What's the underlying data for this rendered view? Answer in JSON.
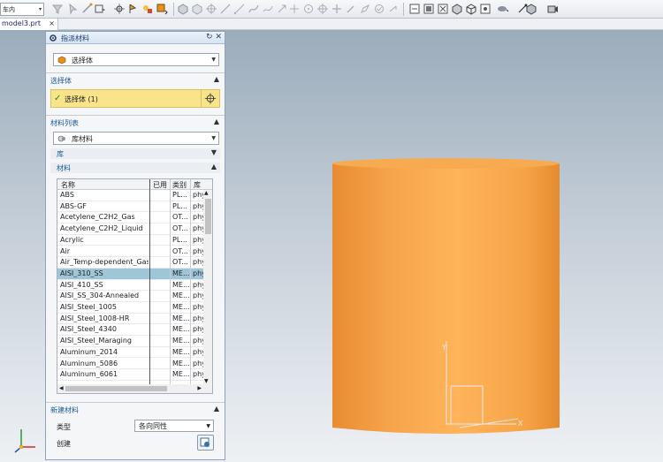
{
  "toolbar": {
    "filter_value": "车内",
    "filter_arrow": "▾"
  },
  "file_tab": {
    "name": "model3.prt",
    "close": "×"
  },
  "dialog": {
    "title": "指派材料",
    "title_buttons": "↻ ✕",
    "selection_type": "选择体",
    "select_body_section": "选择体",
    "select_body_status": "选择体 (1)",
    "material_list_section": "材料列表",
    "library_combo": "库材料",
    "library_subsection": "库",
    "material_subsection": "材料",
    "columns": {
      "name": "名称",
      "used": "已用",
      "class": "类别",
      "library": "库"
    },
    "materials": [
      {
        "name": "ABS",
        "class": "PL...",
        "library": "phy"
      },
      {
        "name": "ABS-GF",
        "class": "PL...",
        "library": "phy"
      },
      {
        "name": "Acetylene_C2H2_Gas",
        "class": "OT...",
        "library": "phy"
      },
      {
        "name": "Acetylene_C2H2_Liquid",
        "class": "OT...",
        "library": "phy"
      },
      {
        "name": "Acrylic",
        "class": "PL...",
        "library": "phy"
      },
      {
        "name": "Air",
        "class": "OT...",
        "library": "phy"
      },
      {
        "name": "Air_Temp-dependent_Gas",
        "class": "OT...",
        "library": "phy"
      },
      {
        "name": "AISI_310_SS",
        "class": "ME...",
        "library": "phy"
      },
      {
        "name": "AISI_410_SS",
        "class": "ME...",
        "library": "phy"
      },
      {
        "name": "AISI_SS_304-Annealed",
        "class": "ME...",
        "library": "phy"
      },
      {
        "name": "AISI_Steel_1005",
        "class": "ME...",
        "library": "phy"
      },
      {
        "name": "AISI_Steel_1008-HR",
        "class": "ME...",
        "library": "phy"
      },
      {
        "name": "AISI_Steel_4340",
        "class": "ME...",
        "library": "phy"
      },
      {
        "name": "AISI_Steel_Maraging",
        "class": "ME...",
        "library": "phy"
      },
      {
        "name": "Aluminum_2014",
        "class": "ME...",
        "library": "phy"
      },
      {
        "name": "Aluminum_5086",
        "class": "ME...",
        "library": "phy"
      },
      {
        "name": "Aluminum_6061",
        "class": "ME...",
        "library": "phy"
      }
    ],
    "selected_material": "AISI_310_SS",
    "new_material_section": "新建材料",
    "type_label": "类型",
    "type_value": "各向同性",
    "create_label": "创建"
  },
  "colors": {
    "body": "#f8a64c",
    "selection": "#9fc6d7",
    "highlight": "#f9e48b",
    "viewport_top": "#9bacbb"
  }
}
